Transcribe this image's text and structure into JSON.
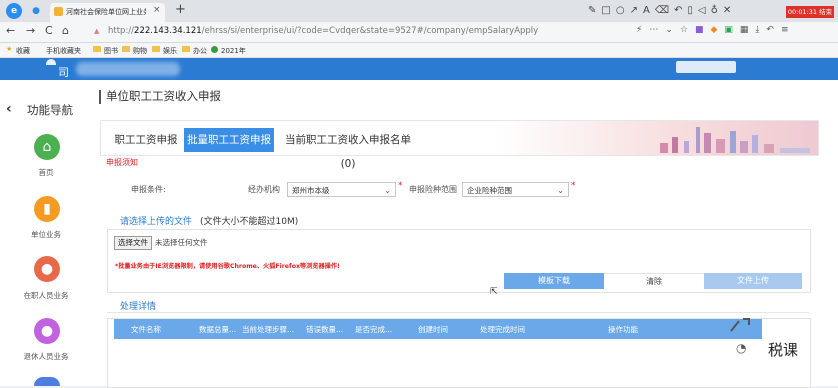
{
  "browser": {
    "tab_title": "河南社会保险单位网上业务大",
    "new_tab_symbol": "+",
    "url_prefix": "http://",
    "url_host": "222.143.34.121",
    "url_path": "/ehrss/si/enterprise/ui/?code=Cvdqer&state=9527#/company/empSalaryApply",
    "timer": "00:01:31 结束",
    "bookmarks": [
      "收藏",
      "手机收藏夹",
      "图书",
      "购物",
      "娱乐",
      "办公",
      "2021年"
    ]
  },
  "header": {
    "company_suffix": "司"
  },
  "sidebar": {
    "title": "功能导航",
    "back_icon": "chevron-left-icon",
    "items": [
      {
        "label": "首页",
        "icon": "home-icon",
        "color": "#4caf50"
      },
      {
        "label": "单位业务",
        "icon": "building-icon",
        "color": "#f59a23"
      },
      {
        "label": "在职人员业务",
        "icon": "person-icon",
        "color": "#e8684a"
      },
      {
        "label": "退休人员业务",
        "icon": "person-icon",
        "color": "#c162e0"
      }
    ]
  },
  "page": {
    "title": "单位职工工资收入申报",
    "tabs": [
      "职工工资申报",
      "批量职工工资申报",
      "当前职工工资收入申报名单(0)"
    ],
    "active_tab": 1,
    "notice_link": "申报须知",
    "condition_label": "申报条件:",
    "agency_label": "经办机构",
    "agency_value": "郑州市本级",
    "scope_label": "申报险种范围",
    "scope_value": "企业险种范围",
    "required_mark": "*",
    "upload_title": "请选择上传的文件",
    "upload_hint": "(文件大小不能超过10M)",
    "choose_file_button": "选择文件",
    "no_file_text": "未选择任何文件",
    "warning": "*批量业务由于IE浏览器限制，请使用谷歌Chrome、火狐Firefox等浏览器操作!",
    "template_button": "模板下载",
    "clear_button": "清除",
    "upload_button": "文件上传",
    "detail_title": "处理详情",
    "table_headers": [
      "文件名称",
      "数据总量...",
      "当前处理步骤...",
      "错误数量...",
      "是否完成...",
      "创建时间",
      "处理完成时间",
      "操作功能"
    ]
  },
  "watermark": {
    "text": "税课"
  },
  "colors": {
    "accent": "#2c7bd3",
    "tab_active": "#3a8ee6",
    "table_head": "#6aa8ea",
    "warning": "#e02020"
  }
}
